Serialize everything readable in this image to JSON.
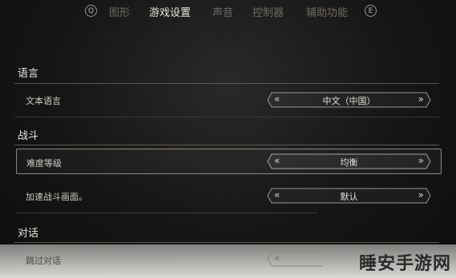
{
  "topnav": {
    "left_key": "Q",
    "right_key": "E",
    "tabs": [
      "图形",
      "游戏设置",
      "声音",
      "控制器",
      "辅助功能"
    ],
    "active_tab": "游戏设置"
  },
  "sections": {
    "language": {
      "title": "语言",
      "rows": [
        {
          "label": "文本语言",
          "value": "中文（中国）"
        }
      ]
    },
    "combat": {
      "title": "战斗",
      "rows": [
        {
          "label": "难度等级",
          "value": "均衡",
          "selected": true
        },
        {
          "label": "加速战斗画面。",
          "value": "默认"
        }
      ]
    },
    "dialogue": {
      "title": "对话",
      "rows": [
        {
          "label": "跳过对话",
          "value": ""
        }
      ]
    }
  },
  "arrows": {
    "left": "«",
    "right": "»"
  },
  "watermark": "睡安手游网"
}
